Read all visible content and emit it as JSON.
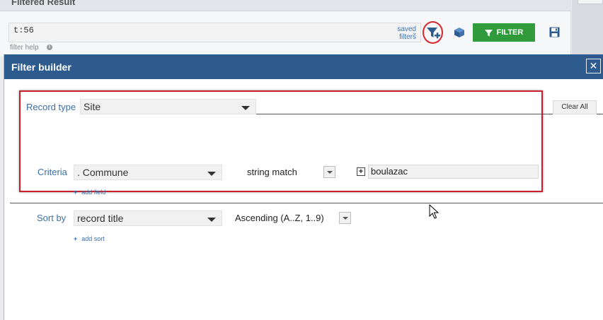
{
  "background": {
    "panel_title": "Filtered Result",
    "filter_query": "t:56",
    "saved_filters_line1": "saved",
    "saved_filters_line2": "filters",
    "filter_button": "FILTER",
    "filter_help": "filter help",
    "help_icon_glyph": "i"
  },
  "dialog": {
    "title": "Filter builder",
    "close_glyph": "✕",
    "clear_all": "Clear All",
    "record_type": {
      "label": "Record type",
      "value": "Site"
    },
    "criteria": {
      "label": "Criteria",
      "field": ". Commune",
      "operator": "string match",
      "value": "boulazac",
      "plus_glyph": "+"
    },
    "add_field": "add field",
    "sort": {
      "label": "Sort by",
      "field": "record title",
      "order": "Ascending (A..Z, 1..9)"
    },
    "add_sort": "add sort",
    "plus_glyph": "+"
  },
  "colors": {
    "header_blue": "#2e5b8e",
    "filter_green": "#2f9b3a",
    "highlight_red": "#c81e27",
    "label_blue": "#3a6fa8"
  },
  "icons": [
    "funnel-add-icon",
    "cube-icon",
    "funnel-icon",
    "save-icon",
    "info-icon",
    "close-icon",
    "mouse-cursor-icon"
  ]
}
